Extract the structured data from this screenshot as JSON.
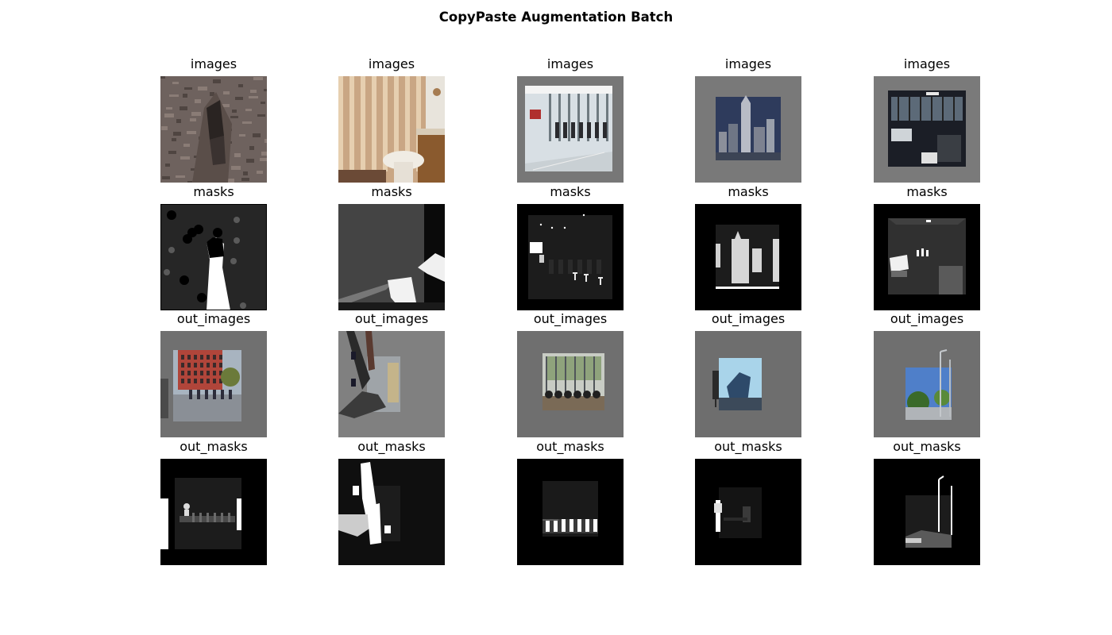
{
  "figure": {
    "title": "CopyPaste Augmentation Batch"
  },
  "rows": [
    {
      "key": "images",
      "label": "images"
    },
    {
      "key": "masks",
      "label": "masks"
    },
    {
      "key": "out_images",
      "label": "out_images"
    },
    {
      "key": "out_masks",
      "label": "out_masks"
    }
  ],
  "columns": 5,
  "panels": {
    "images": [
      {
        "label": "images",
        "content": "rocky ground with dark crevice",
        "colors": {
          "bg": "#6e625e",
          "accent": "#2a2422"
        }
      },
      {
        "label": "images",
        "content": "bathroom with striped curtain and toilet",
        "colors": {
          "bg": "#c9a684",
          "accent": "#f0ece4"
        }
      },
      {
        "label": "images",
        "content": "office interior with people at desks",
        "colors": {
          "bg": "#777777",
          "accent": "#d8dfe4"
        }
      },
      {
        "label": "images",
        "content": "city skyline at night",
        "colors": {
          "bg": "#797979",
          "accent": "#2e3b5c"
        }
      },
      {
        "label": "images",
        "content": "dark hotel room with windows",
        "colors": {
          "bg": "#7a7a7a",
          "accent": "#1b1e26"
        }
      }
    ],
    "masks": [
      {
        "label": "masks",
        "content": "segmentation mask",
        "colors": {
          "bg": "#262626",
          "accent": "#ffffff"
        }
      },
      {
        "label": "masks",
        "content": "segmentation mask",
        "colors": {
          "bg": "#444444",
          "accent": "#f2f2f2"
        }
      },
      {
        "label": "masks",
        "content": "segmentation mask",
        "colors": {
          "bg": "#000000",
          "accent": "#1c1c1c"
        }
      },
      {
        "label": "masks",
        "content": "segmentation mask",
        "colors": {
          "bg": "#000000",
          "accent": "#d6d6d6"
        }
      },
      {
        "label": "masks",
        "content": "segmentation mask",
        "colors": {
          "bg": "#000000",
          "accent": "#303030"
        }
      }
    ],
    "out_images": [
      {
        "label": "out_images",
        "content": "street with red building and pedestrians",
        "colors": {
          "bg": "#707070",
          "accent": "#b0453a"
        }
      },
      {
        "label": "out_images",
        "content": "pasted objects on grey canvas",
        "colors": {
          "bg": "#808080",
          "accent": "#3b3b3b"
        }
      },
      {
        "label": "out_images",
        "content": "window scene with seated people",
        "colors": {
          "bg": "#6f6f6f",
          "accent": "#8fa37c"
        }
      },
      {
        "label": "out_images",
        "content": "sky with statue",
        "colors": {
          "bg": "#6e6e6e",
          "accent": "#a9d4ea"
        }
      },
      {
        "label": "out_images",
        "content": "blue sky with trees and street lamps",
        "colors": {
          "bg": "#6f6f6f",
          "accent": "#4f7fc9"
        }
      }
    ],
    "out_masks": [
      {
        "label": "out_masks",
        "content": "segmentation mask",
        "colors": {
          "bg": "#000000",
          "accent": "#ffffff"
        }
      },
      {
        "label": "out_masks",
        "content": "segmentation mask",
        "colors": {
          "bg": "#0f0f0f",
          "accent": "#ffffff"
        }
      },
      {
        "label": "out_masks",
        "content": "segmentation mask",
        "colors": {
          "bg": "#000000",
          "accent": "#ffffff"
        }
      },
      {
        "label": "out_masks",
        "content": "segmentation mask",
        "colors": {
          "bg": "#000000",
          "accent": "#ffffff"
        }
      },
      {
        "label": "out_masks",
        "content": "segmentation mask",
        "colors": {
          "bg": "#000000",
          "accent": "#cccccc"
        }
      }
    ]
  }
}
